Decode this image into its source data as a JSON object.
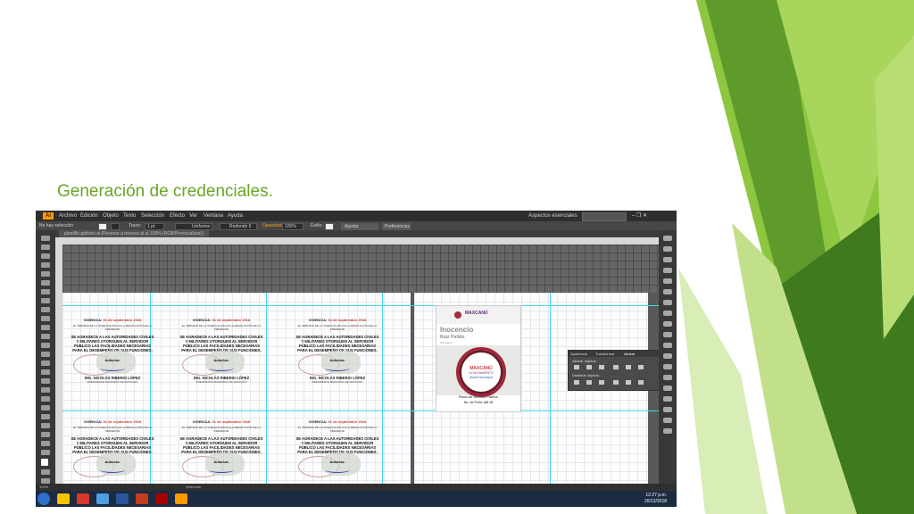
{
  "slide": {
    "title": "Generación de credenciales.",
    "accent_colors": [
      "#8dc63f",
      "#5e9b2a",
      "#3f7a1e",
      "#c2e08a"
    ]
  },
  "app": {
    "logo": "Ai",
    "menu": [
      "Archivo",
      "Edición",
      "Objeto",
      "Texto",
      "Selección",
      "Efecto",
      "Ver",
      "Ventana",
      "Ayuda"
    ],
    "workspace": "Aspectos esenciales",
    "window_buttons": "– ❐ ✕",
    "control_bar": {
      "selection_label": "No hay selección",
      "stroke_label": "Trazo:",
      "stroke_value": "1 pt",
      "profile_value": "Uniforme",
      "brush_value": "Redondo 5 pt",
      "opacity_label": "Opacidad:",
      "opacity_value": "100%",
      "style_label": "Estilo:",
      "doc_setup_button": "Ajustar documento",
      "preferences_button": "Preferencias"
    },
    "document_tab": "plantilla gafetes.ai (Reverse a reverso.ai al 100% (RGB/Previsualizar))"
  },
  "credentials": [
    {
      "vigencia": "VIGENCIA:",
      "fecha": "31 de septiembre 2018",
      "small": "EL TÉRMINO DE LA VIGENCIA APLICA LA RESOLUCIÓN DE LA PRESENTE",
      "mensaje": "SE AGRADECE A LAS AUTORIDADES CIVILES Y MILITARES OTORGUEN AL SERVIDOR PÚBLICO LAS FACILIDADES NECESARIAS PARA EL DESEMPEÑO DE SUS FUNCIONES.",
      "autoriza": "Autoriza:",
      "firmante": "ING. NICOLÁS RIBERIO LÓPEZ",
      "cargo": "PRESIDENTE MUNICIPAL DE MAXCANÚ"
    }
  ],
  "badge": {
    "logo_text": "MAXCANÚ",
    "name": "Inocencio",
    "surname": "Ruiz Pulido.",
    "subtitle": "Mensajero",
    "circle_line1": "MAXCANÚ",
    "circle_line2": "AYUNTAMIENTO",
    "circle_line3": "Madre Municipal",
    "footer1": "Firma del Servidor Público",
    "footer2": "No. de Folio: AM 18"
  },
  "align_panel": {
    "tabs": [
      "Apariencia",
      "Transformar",
      "Alinear"
    ],
    "align_objects": "Alinear objetos:",
    "distribute_objects": "Distribuir objetos:"
  },
  "status": {
    "zoom": "100%",
    "tool": "Selección"
  },
  "taskbar": {
    "time": "12:27 p.m.",
    "date": "20/12/2018",
    "app_colors": [
      "#f5c400",
      "#d8382c",
      "#4fa0e0",
      "#2b579a",
      "#c43e1c",
      "#a80000",
      "#ff9a00"
    ]
  }
}
